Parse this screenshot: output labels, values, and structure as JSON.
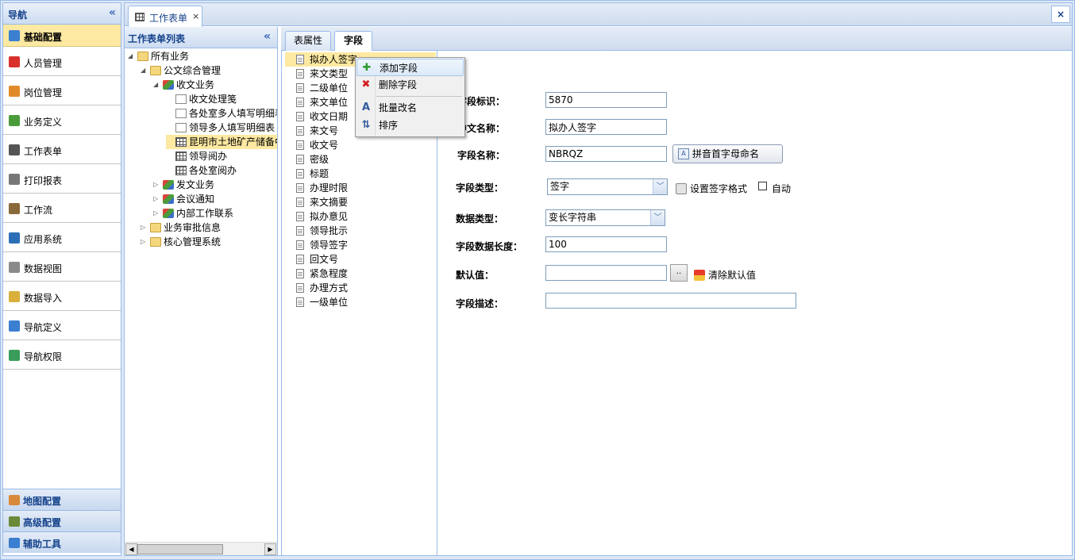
{
  "nav": {
    "title": "导航",
    "collapse": "«",
    "items": [
      {
        "label": "基础配置",
        "icon": "gear-icon",
        "color": "#3a7fd0"
      },
      {
        "label": "人员管理",
        "icon": "user-icon",
        "color": "#d9302c"
      },
      {
        "label": "岗位管理",
        "icon": "users-icon",
        "color": "#e08a2a"
      },
      {
        "label": "业务定义",
        "icon": "business-icon",
        "color": "#4a9c3a"
      },
      {
        "label": "工作表单",
        "icon": "grid-icon",
        "color": "#555555"
      },
      {
        "label": "打印报表",
        "icon": "printer-icon",
        "color": "#777777"
      },
      {
        "label": "工作流",
        "icon": "workflow-icon",
        "color": "#8a6a3a"
      },
      {
        "label": "应用系统",
        "icon": "app-icon",
        "color": "#2c6fb7"
      },
      {
        "label": "数据视图",
        "icon": "database-icon",
        "color": "#8a8a8a"
      },
      {
        "label": "数据导入",
        "icon": "import-icon",
        "color": "#d8b03a"
      },
      {
        "label": "导航定义",
        "icon": "nav-def-icon",
        "color": "#3a7fd0"
      },
      {
        "label": "导航权限",
        "icon": "permission-icon",
        "color": "#3a9c5a"
      }
    ],
    "bottom": [
      {
        "label": "地图配置",
        "icon": "map-icon",
        "color": "#d88a3a"
      },
      {
        "label": "高级配置",
        "icon": "advanced-icon",
        "color": "#6a8a3a"
      },
      {
        "label": "辅助工具",
        "icon": "tools-icon",
        "color": "#3a7fd0"
      }
    ]
  },
  "main_tab": {
    "label": "工作表单",
    "close": "×"
  },
  "panel_close": "×",
  "tree": {
    "title": "工作表单列表",
    "collapse": "«",
    "nodes": [
      {
        "label": "所有业务",
        "depth": 0,
        "arrow": "◢",
        "icon": "folder"
      },
      {
        "label": "公文综合管理",
        "depth": 1,
        "arrow": "◢",
        "icon": "folder"
      },
      {
        "label": "收文业务",
        "depth": 2,
        "arrow": "◢",
        "icon": "biz"
      },
      {
        "label": "收文处理笺",
        "depth": 3,
        "arrow": "",
        "icon": "doc"
      },
      {
        "label": "各处室多人填写明细表",
        "depth": 3,
        "arrow": "",
        "icon": "doc"
      },
      {
        "label": "领导多人填写明细表",
        "depth": 3,
        "arrow": "",
        "icon": "doc"
      },
      {
        "label": "昆明市土地矿产储备中心",
        "depth": 3,
        "arrow": "",
        "icon": "grid",
        "selected": true
      },
      {
        "label": "领导阅办",
        "depth": 3,
        "arrow": "",
        "icon": "grid"
      },
      {
        "label": "各处室阅办",
        "depth": 3,
        "arrow": "",
        "icon": "grid"
      },
      {
        "label": "发文业务",
        "depth": 2,
        "arrow": "▷",
        "icon": "biz"
      },
      {
        "label": "会议通知",
        "depth": 2,
        "arrow": "▷",
        "icon": "biz"
      },
      {
        "label": "内部工作联系",
        "depth": 2,
        "arrow": "▷",
        "icon": "biz"
      },
      {
        "label": "业务审批信息",
        "depth": 1,
        "arrow": "▷",
        "icon": "folder"
      },
      {
        "label": "核心管理系统",
        "depth": 1,
        "arrow": "▷",
        "icon": "folder"
      }
    ],
    "scroll_left": "◀",
    "scroll_right": "▶"
  },
  "subtabs": [
    {
      "label": "表属性",
      "active": false
    },
    {
      "label": "字段",
      "active": true
    }
  ],
  "fields": [
    "拟办人签字",
    "来文类型",
    "二级单位",
    "来文单位",
    "收文日期",
    "来文号",
    "收文号",
    "密级",
    "标题",
    "办理时限",
    "来文摘要",
    "拟办意见",
    "领导批示",
    "领导签字",
    "回文号",
    "紧急程度",
    "办理方式",
    "一级单位"
  ],
  "context_menu": [
    {
      "label": "添加字段",
      "icon": "add-icon",
      "glyph": "✚",
      "color": "#2f9a2f"
    },
    {
      "label": "删除字段",
      "icon": "delete-icon",
      "glyph": "✖",
      "color": "#d42020"
    },
    {
      "label": "批量改名",
      "icon": "rename-icon",
      "glyph": "A",
      "color": "#325b9c"
    },
    {
      "label": "排序",
      "icon": "sort-icon",
      "glyph": "⇅",
      "color": "#325b9c"
    }
  ],
  "form": {
    "id_label": "字段标识：",
    "id_value": "5870",
    "cn_label": "中文名称：",
    "cn_value": "拟办人签字",
    "name_label": "字段名称：",
    "name_value": "NBRQZ",
    "pinyin_btn": "拼音首字母命名",
    "type_label": "字段类型：",
    "type_value": "签字",
    "sign_fmt": "设置签字格式",
    "auto_label": "自动",
    "data_type_label": "数据类型：",
    "data_type_value": "变长字符串",
    "length_label": "字段数据长度：",
    "length_value": "100",
    "default_label": "默认值：",
    "default_value": "",
    "default_btn": "..",
    "clear_default": "清除默认值",
    "desc_label": "字段描述：",
    "desc_value": ""
  }
}
